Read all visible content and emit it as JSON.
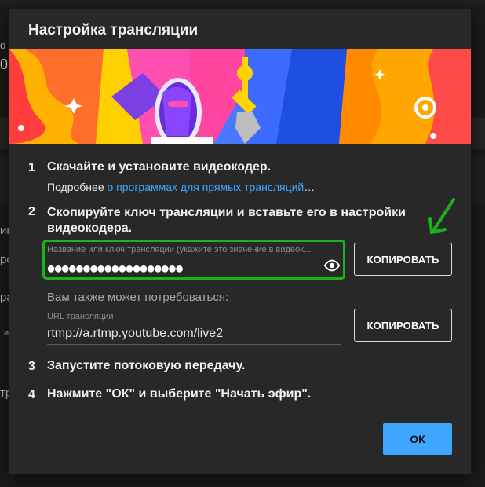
{
  "dialog": {
    "title": "Настройка трансляции"
  },
  "steps": [
    {
      "num": "1",
      "text": "Скачайте и установите видеокодер.",
      "sub_prefix": "Подробнее ",
      "sub_link": "о программах для прямых трансляций",
      "sub_suffix": "…"
    },
    {
      "num": "2",
      "text": "Скопируйте ключ трансляции и вставьте его в настройки видеокодера."
    },
    {
      "num": "3",
      "text": "Запустите потоковую передачу."
    },
    {
      "num": "4",
      "text": "Нажмите \"ОК\" и выберите \"Начать эфир\"."
    }
  ],
  "stream_key": {
    "label": "Название или ключ трансляции (укажите это значение в видеок...",
    "masked_value": "●●●●●●●●●●●●●●●●●●●",
    "copy_label": "КОПИРОВАТЬ"
  },
  "also_needed": "Вам также может потребоваться:",
  "stream_url": {
    "label": "URL трансляции",
    "value": "rtmp://a.rtmp.youtube.com/live2",
    "copy_label": "КОПИРОВАТЬ"
  },
  "ok_label": "ОК",
  "background_edge": [
    "о",
    "0",
    "ин",
    "ро",
    "ра",
    "ти",
    "тр"
  ],
  "colors": {
    "accent": "#3ea6ff",
    "highlight": "#1bb21b",
    "dialog_bg": "#282828"
  }
}
